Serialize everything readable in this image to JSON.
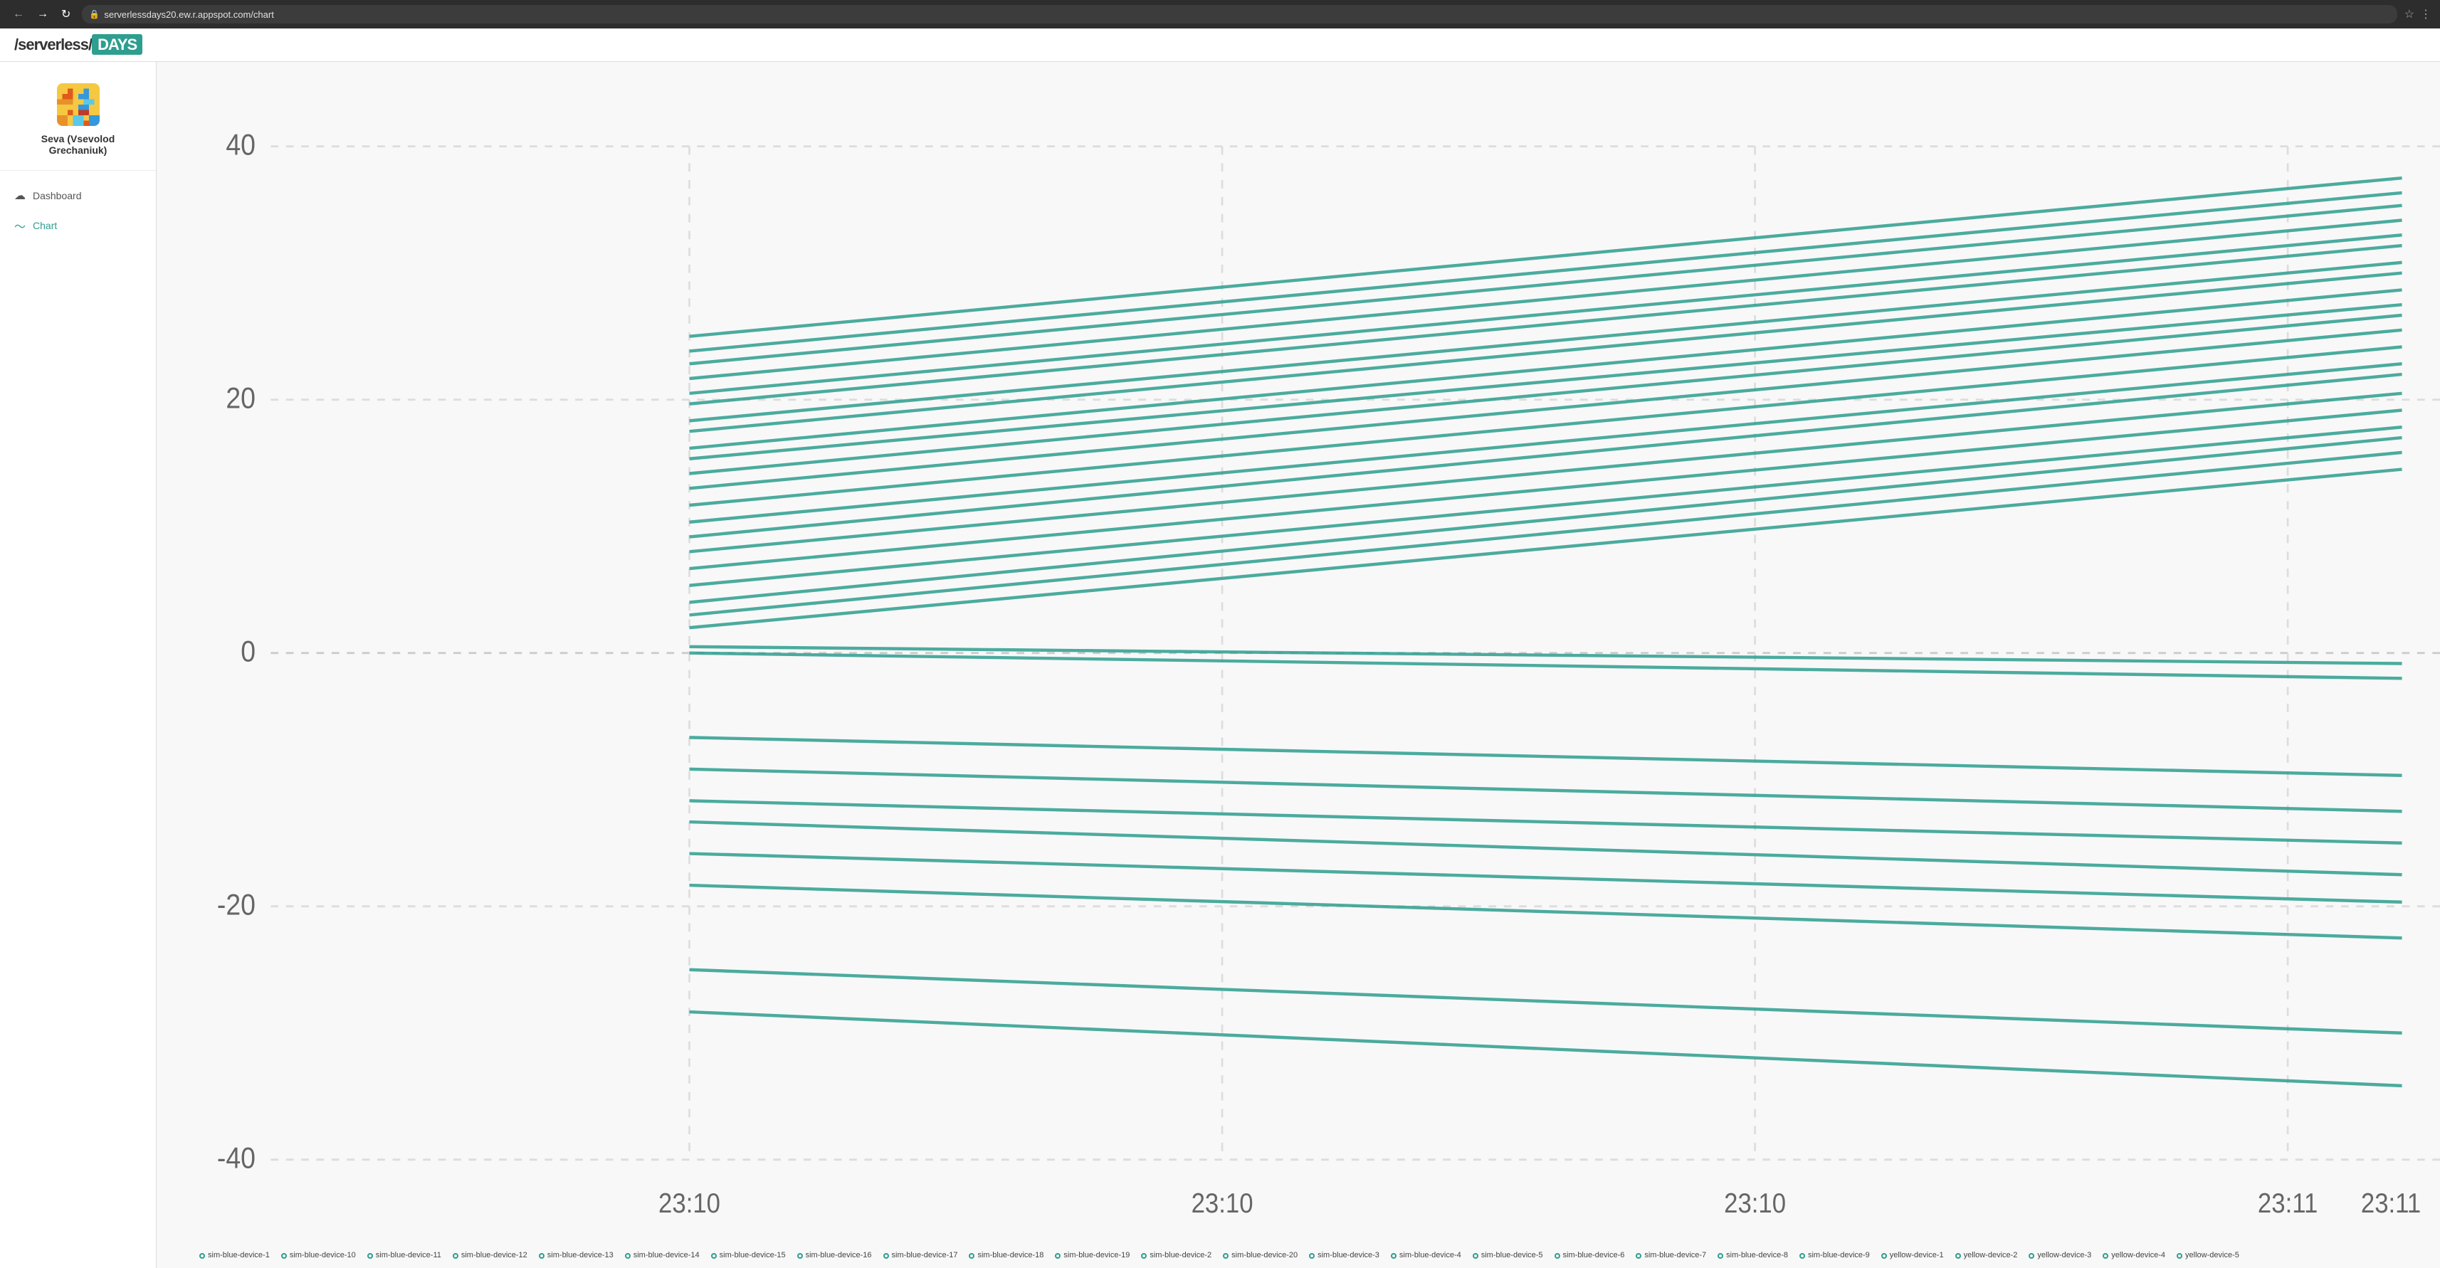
{
  "browser": {
    "url": "serverlessdays20.ew.r.appspot.com/chart",
    "back_label": "←",
    "forward_label": "→",
    "reload_label": "↻",
    "star_label": "☆",
    "menu_label": "⋮"
  },
  "app": {
    "logo_prefix": "/serverless/",
    "logo_days": "DAYS"
  },
  "user": {
    "name": "Seva (Vsevolod\nGrechaniuk)"
  },
  "nav": {
    "items": [
      {
        "id": "dashboard",
        "label": "Dashboard",
        "icon": "cloud",
        "active": false
      },
      {
        "id": "chart",
        "label": "Chart",
        "icon": "chart",
        "active": true
      }
    ]
  },
  "chart": {
    "y_axis_labels": [
      "40",
      "20",
      "0",
      "-20",
      "-40"
    ],
    "x_axis_labels": [
      "23:10",
      "23:10",
      "23:10",
      "23:11",
      "23:11"
    ],
    "color": "#2d9e8f",
    "legend_items": [
      "sim-blue-device-1",
      "sim-blue-device-10",
      "sim-blue-device-11",
      "sim-blue-device-12",
      "sim-blue-device-13",
      "sim-blue-device-14",
      "sim-blue-device-15",
      "sim-blue-device-16",
      "sim-blue-device-17",
      "sim-blue-device-18",
      "sim-blue-device-19",
      "sim-blue-device-2",
      "sim-blue-device-20",
      "sim-blue-device-3",
      "sim-blue-device-4",
      "sim-blue-device-5",
      "sim-blue-device-6",
      "sim-blue-device-7",
      "sim-blue-device-8",
      "sim-blue-device-9",
      "yellow-device-1",
      "yellow-device-2",
      "yellow-device-3",
      "yellow-device-4",
      "yellow-device-5"
    ]
  }
}
